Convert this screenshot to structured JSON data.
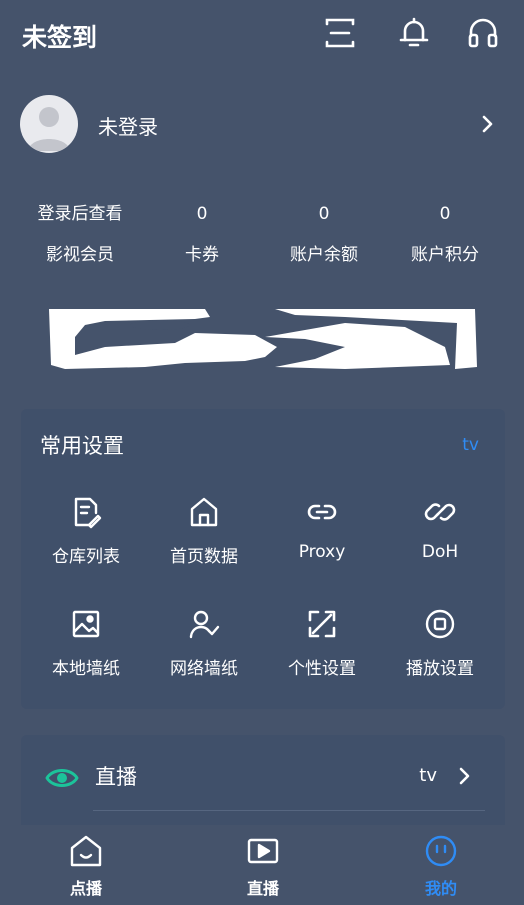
{
  "header": {
    "title": "未签到",
    "icons": [
      "scan-icon",
      "bell-icon",
      "headset-icon"
    ]
  },
  "profile": {
    "name": "未登录"
  },
  "stats": [
    {
      "value": "登录后查看",
      "label": "影视会员"
    },
    {
      "value": "0",
      "label": "卡券"
    },
    {
      "value": "0",
      "label": "账户余额"
    },
    {
      "value": "0",
      "label": "账户积分"
    }
  ],
  "settings": {
    "title": "常用设置",
    "tag": "tv",
    "items": [
      {
        "label": "仓库列表",
        "icon": "edit-document-icon"
      },
      {
        "label": "首页数据",
        "icon": "home-icon"
      },
      {
        "label": "Proxy",
        "icon": "link-icon"
      },
      {
        "label": "DoH",
        "icon": "chain-link-icon"
      },
      {
        "label": "本地墙纸",
        "icon": "image-icon"
      },
      {
        "label": "网络墙纸",
        "icon": "user-check-icon"
      },
      {
        "label": "个性设置",
        "icon": "expand-icon"
      },
      {
        "label": "播放设置",
        "icon": "stop-circle-icon"
      }
    ]
  },
  "live": {
    "label": "直播",
    "value": "tv"
  },
  "nav": {
    "items": [
      {
        "label": "点播",
        "icon": "home-smile-icon",
        "active": false
      },
      {
        "label": "直播",
        "icon": "play-box-icon",
        "active": false
      },
      {
        "label": "我的",
        "icon": "face-icon",
        "active": true
      }
    ]
  },
  "colors": {
    "background": "#45536b",
    "card": "#40506a",
    "accent": "#2f8cf5",
    "live_eye": "#1cc39a"
  }
}
